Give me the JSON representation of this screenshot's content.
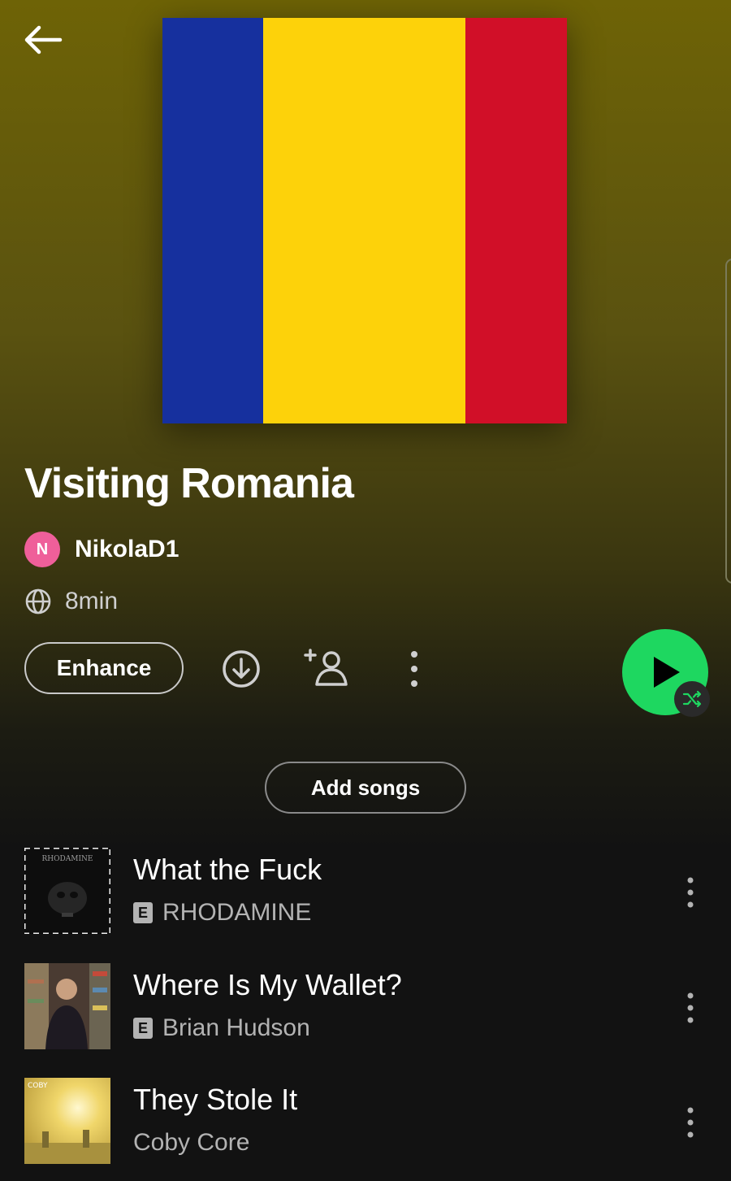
{
  "header": {
    "back_icon": "arrow-left-icon",
    "cover": {
      "type": "flag-romania",
      "colors": [
        "#16309e",
        "#fdd20a",
        "#d10f28"
      ]
    }
  },
  "playlist": {
    "title": "Visiting Romania",
    "owner": {
      "initial": "N",
      "name": "NikolaD1",
      "avatar_color": "#ef5f9a"
    },
    "visibility_icon": "globe-icon",
    "duration": "8min"
  },
  "actions": {
    "enhance_label": "Enhance",
    "download_icon": "download-icon",
    "add_collaborator_icon": "add-user-icon",
    "more_icon": "more-vertical-icon",
    "play_icon": "play-icon",
    "shuffle_icon": "shuffle-icon",
    "play_color": "#1ed760",
    "add_songs_label": "Add songs"
  },
  "tracks": [
    {
      "title": "What the Fuck",
      "explicit": true,
      "explicit_label": "E",
      "artist": "RHODAMINE",
      "art_text": "RHODAMINE"
    },
    {
      "title": "Where Is My Wallet?",
      "explicit": true,
      "explicit_label": "E",
      "artist": "Brian Hudson",
      "art_text": ""
    },
    {
      "title": "They Stole It",
      "explicit": false,
      "explicit_label": "",
      "artist": "Coby Core",
      "art_text": "COBY"
    }
  ]
}
